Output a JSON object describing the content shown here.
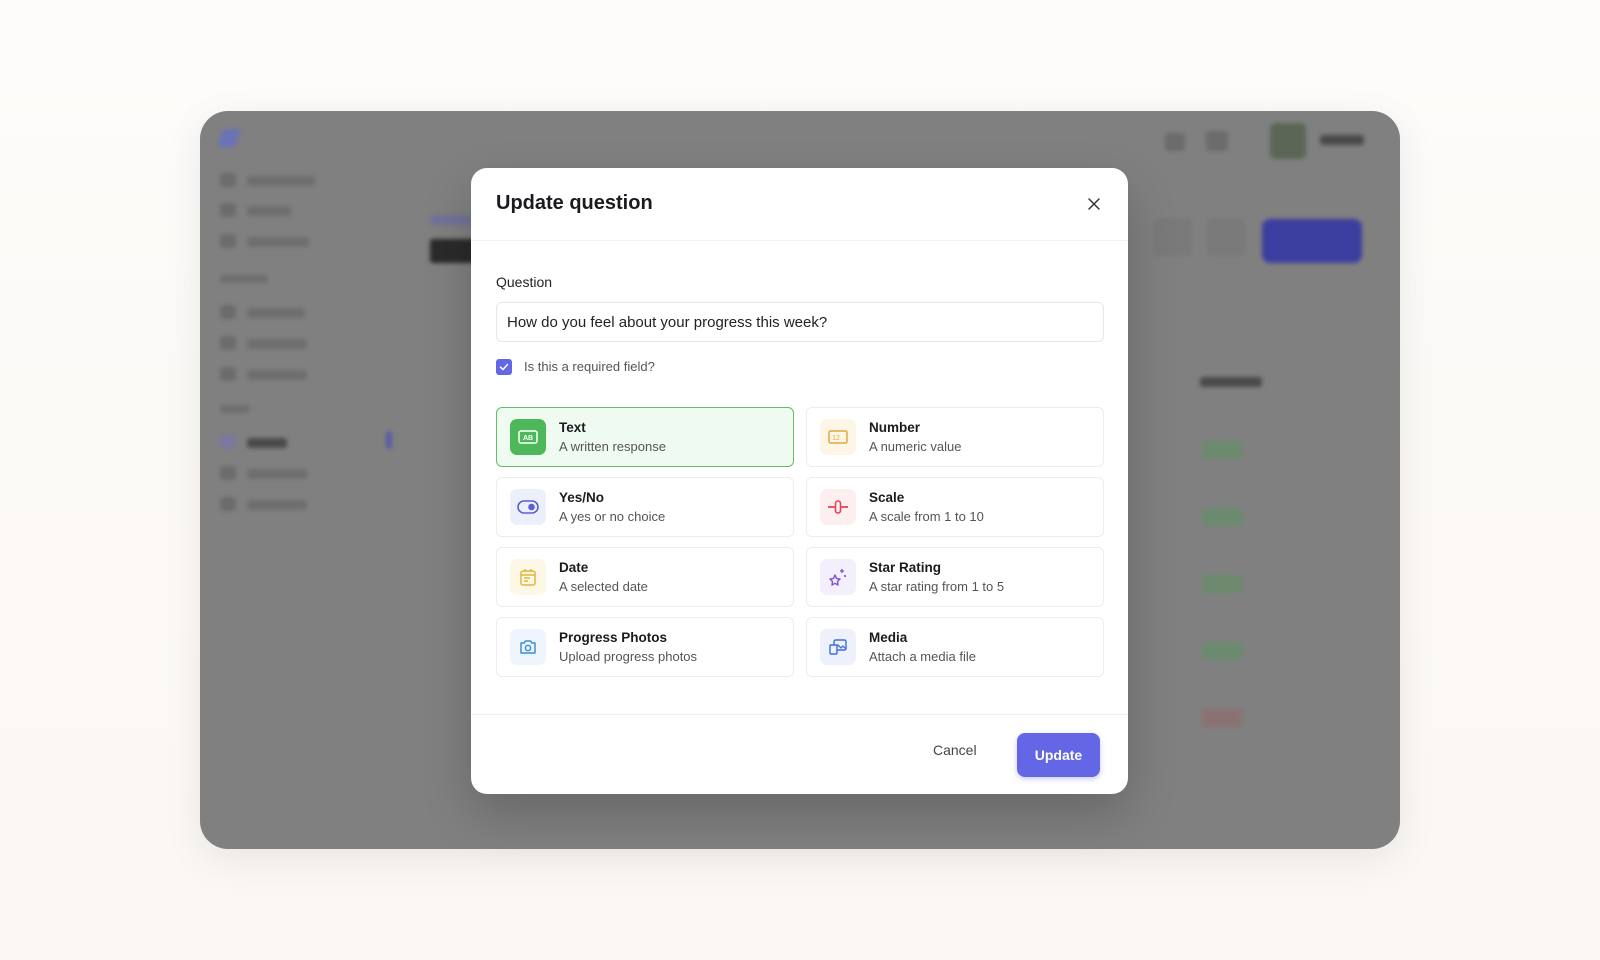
{
  "modal": {
    "title": "Update question",
    "question_label": "Question",
    "question_value": "How do you feel about your progress this week?",
    "required_label": "Is this a required field?",
    "required_checked": true,
    "types": [
      {
        "title": "Text",
        "desc": "A written response",
        "icon": "text-ab-icon",
        "color": "#4cb85a",
        "selected": true
      },
      {
        "title": "Number",
        "desc": "A numeric value",
        "icon": "number-icon",
        "color": "#e2a93b",
        "selected": false
      },
      {
        "title": "Yes/No",
        "desc": "A yes or no choice",
        "icon": "toggle-icon",
        "color": "#5b5fd6",
        "selected": false
      },
      {
        "title": "Scale",
        "desc": "A scale from 1 to 10",
        "icon": "scale-slider-icon",
        "color": "#e0455a",
        "selected": false
      },
      {
        "title": "Date",
        "desc": "A selected date",
        "icon": "calendar-icon",
        "color": "#e2b73b",
        "selected": false
      },
      {
        "title": "Star Rating",
        "desc": "A star rating from 1 to 5",
        "icon": "sparkle-star-icon",
        "color": "#7b52d9",
        "selected": false
      },
      {
        "title": "Progress Photos",
        "desc": "Upload progress photos",
        "icon": "camera-icon",
        "color": "#3f8fd9",
        "selected": false
      },
      {
        "title": "Media",
        "desc": "Attach a media file",
        "icon": "media-gallery-icon",
        "color": "#3f6fd9",
        "selected": false
      }
    ],
    "cancel_label": "Cancel",
    "update_label": "Update"
  },
  "colors": {
    "accent": "#6366e5",
    "selected_border": "#5fbf6a",
    "selected_bg": "#effbf0"
  }
}
